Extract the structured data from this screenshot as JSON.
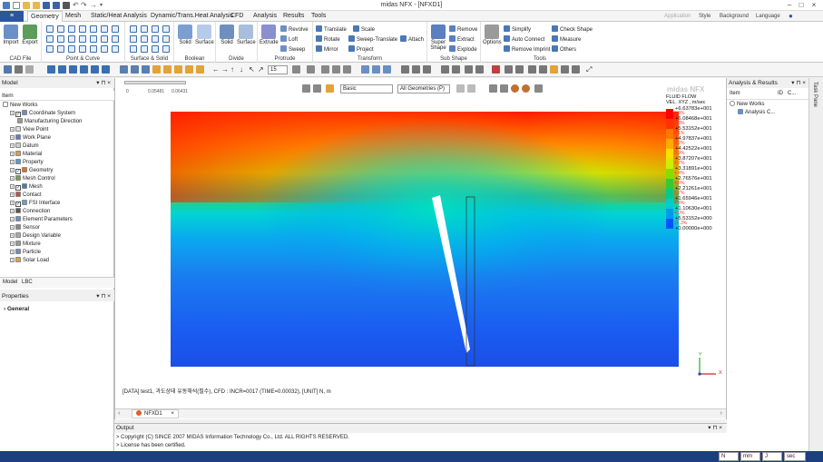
{
  "window": {
    "title": "midas NFX - [NFXD1]"
  },
  "menu": {
    "file_label": "≡",
    "tabs": [
      "Geometry",
      "Mesh",
      "Static/Heat Analysis",
      "Dynamic/Trans.Heat Analysis",
      "CFD",
      "Analysis",
      "Results",
      "Tools"
    ],
    "right_items": [
      "Application",
      "Style",
      "Background",
      "Language"
    ]
  },
  "ribbon": {
    "groups": [
      {
        "label": "CAD File",
        "buttons": [
          "Import",
          "Export"
        ]
      },
      {
        "label": "Point & Curve"
      },
      {
        "label": "Surface & Solid"
      },
      {
        "label": "Boolean",
        "buttons": [
          "Solid",
          "Surface"
        ]
      },
      {
        "label": "Divide",
        "buttons": [
          "Solid",
          "Surface"
        ]
      },
      {
        "label": "Protrude",
        "buttons": [
          "Extrude"
        ],
        "items": [
          "Revolve",
          "Loft",
          "Sweep"
        ]
      },
      {
        "label": "Transform",
        "items": [
          "Translate",
          "Scale",
          "Rotate",
          "Sweep-Translate",
          "Attach",
          "Mirror",
          "Project"
        ]
      },
      {
        "label": "Sub Shape",
        "buttons": [
          "Super Shape"
        ],
        "items": [
          "Remove",
          "Extract",
          "Explode"
        ]
      },
      {
        "label": "Tools",
        "buttons": [
          "Options"
        ],
        "items": [
          "Simplify",
          "Check Shape",
          "Auto Connect",
          "Measure",
          "Remove Imprint",
          "Others"
        ]
      }
    ]
  },
  "toolbar": {
    "zoom_value": "15"
  },
  "model_panel": {
    "title": "Model",
    "column": "Item",
    "tree": [
      {
        "label": "New Works",
        "level": 0
      },
      {
        "label": "Coordinate System",
        "level": 1
      },
      {
        "label": "Manufacturing Direction",
        "level": 2
      },
      {
        "label": "View Point",
        "level": 1
      },
      {
        "label": "Work Plane",
        "level": 1
      },
      {
        "label": "Datum",
        "level": 1
      },
      {
        "label": "Material",
        "level": 1
      },
      {
        "label": "Property",
        "level": 1
      },
      {
        "label": "Geometry",
        "level": 1
      },
      {
        "label": "Mesh Control",
        "level": 1
      },
      {
        "label": "Mesh",
        "level": 1
      },
      {
        "label": "Contact",
        "level": 1
      },
      {
        "label": "FSI Interface",
        "level": 1
      },
      {
        "label": "Connection",
        "level": 1
      },
      {
        "label": "Element Parameters",
        "level": 1
      },
      {
        "label": "Sensor",
        "level": 1
      },
      {
        "label": "Design Variable",
        "level": 1
      },
      {
        "label": "Mixture",
        "level": 1
      },
      {
        "label": "Particle",
        "level": 1
      },
      {
        "label": "Solar Load",
        "level": 1
      }
    ],
    "bottom_tabs": [
      "Model",
      "LBC"
    ]
  },
  "properties_panel": {
    "title": "Properties",
    "section": "General"
  },
  "viewport": {
    "view_style": "Basic",
    "filter": "All Geometries (P)",
    "tab_label": "NFXD1",
    "scale_ticks": [
      "0",
      "0.05481",
      "0.06431"
    ],
    "status_text": "[DATA] test1, 과도상태 유동해석(필수), CFD : INCR=0017 (TIME=0.00032), [UNIT] N, m",
    "watermark": "midas NFX",
    "legend": {
      "title_line1": "FLUID FLOW",
      "title_line2": "VEL. XYZ , m/sec",
      "entries": [
        {
          "value": "+6.63783e+001",
          "pct": "0.8%",
          "color": "#ff0000"
        },
        {
          "value": "+6.08468e+001",
          "pct": "0.8%",
          "color": "#ff3300"
        },
        {
          "value": "+5.53152e+001",
          "pct": "4.1%",
          "color": "#ff7700"
        },
        {
          "value": "+4.97837e+001",
          "pct": "2.2%",
          "color": "#ffaa00"
        },
        {
          "value": "+4.42522e+001",
          "pct": "3.9%",
          "color": "#ffdd00"
        },
        {
          "value": "+3.87207e+001",
          "pct": "4.7%",
          "color": "#ccee00"
        },
        {
          "value": "+3.31891e+001",
          "pct": "4.4%",
          "color": "#88dd00"
        },
        {
          "value": "+2.76576e+001",
          "pct": "4.8%",
          "color": "#33cc33"
        },
        {
          "value": "+2.21261e+001",
          "pct": "5.7%",
          "color": "#00cc88"
        },
        {
          "value": "+1.65946e+001",
          "pct": "4.4%",
          "color": "#00cccc"
        },
        {
          "value": "+1.10630e+001",
          "pct": "4.0%",
          "color": "#0099ee"
        },
        {
          "value": "+5.53152e+000",
          "pct": "26.3%",
          "color": "#0055ff"
        },
        {
          "value": "+0.00000e+000",
          "pct": "",
          "color": "#0000cc"
        }
      ]
    },
    "axis": {
      "y": "Y",
      "x": "X"
    }
  },
  "analysis_panel": {
    "title": "Analysis & Results",
    "columns": [
      "Item",
      "ID",
      "C..."
    ],
    "tree": [
      {
        "label": "New Works"
      },
      {
        "label": "Analysis C..."
      }
    ]
  },
  "side_tab": {
    "label": "Task Pane"
  },
  "output": {
    "title": "Output",
    "lines": [
      "> Copyright (C) SINCE 2007 MIDAS Information Technology Co., Ltd. ALL RIGHTS RESERVED.",
      "> License has been certified."
    ]
  },
  "statusbar": {
    "units": [
      "N",
      "mm",
      "J",
      "sec"
    ]
  }
}
